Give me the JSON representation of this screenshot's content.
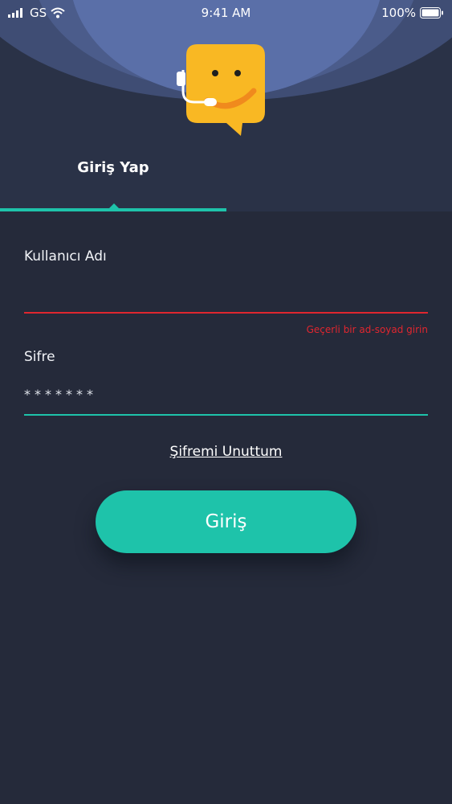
{
  "status_bar": {
    "carrier": "GS",
    "time": "9:41 AM",
    "battery": "100%"
  },
  "tabs": [
    {
      "label": "Giriş Yap",
      "active": true
    }
  ],
  "form": {
    "username": {
      "label": "Kullanıcı Adı",
      "value": "",
      "error": "Geçerli bir ad-soyad girin"
    },
    "password": {
      "label": "Sifre",
      "value": "*******"
    },
    "forgot_password": "Şifremi Unuttum",
    "submit_label": "Giriş"
  },
  "colors": {
    "background": "#252a3a",
    "header": "#2a3247",
    "accent": "#1ec3aa",
    "error": "#e0262f",
    "mascot": "#f9b823"
  }
}
